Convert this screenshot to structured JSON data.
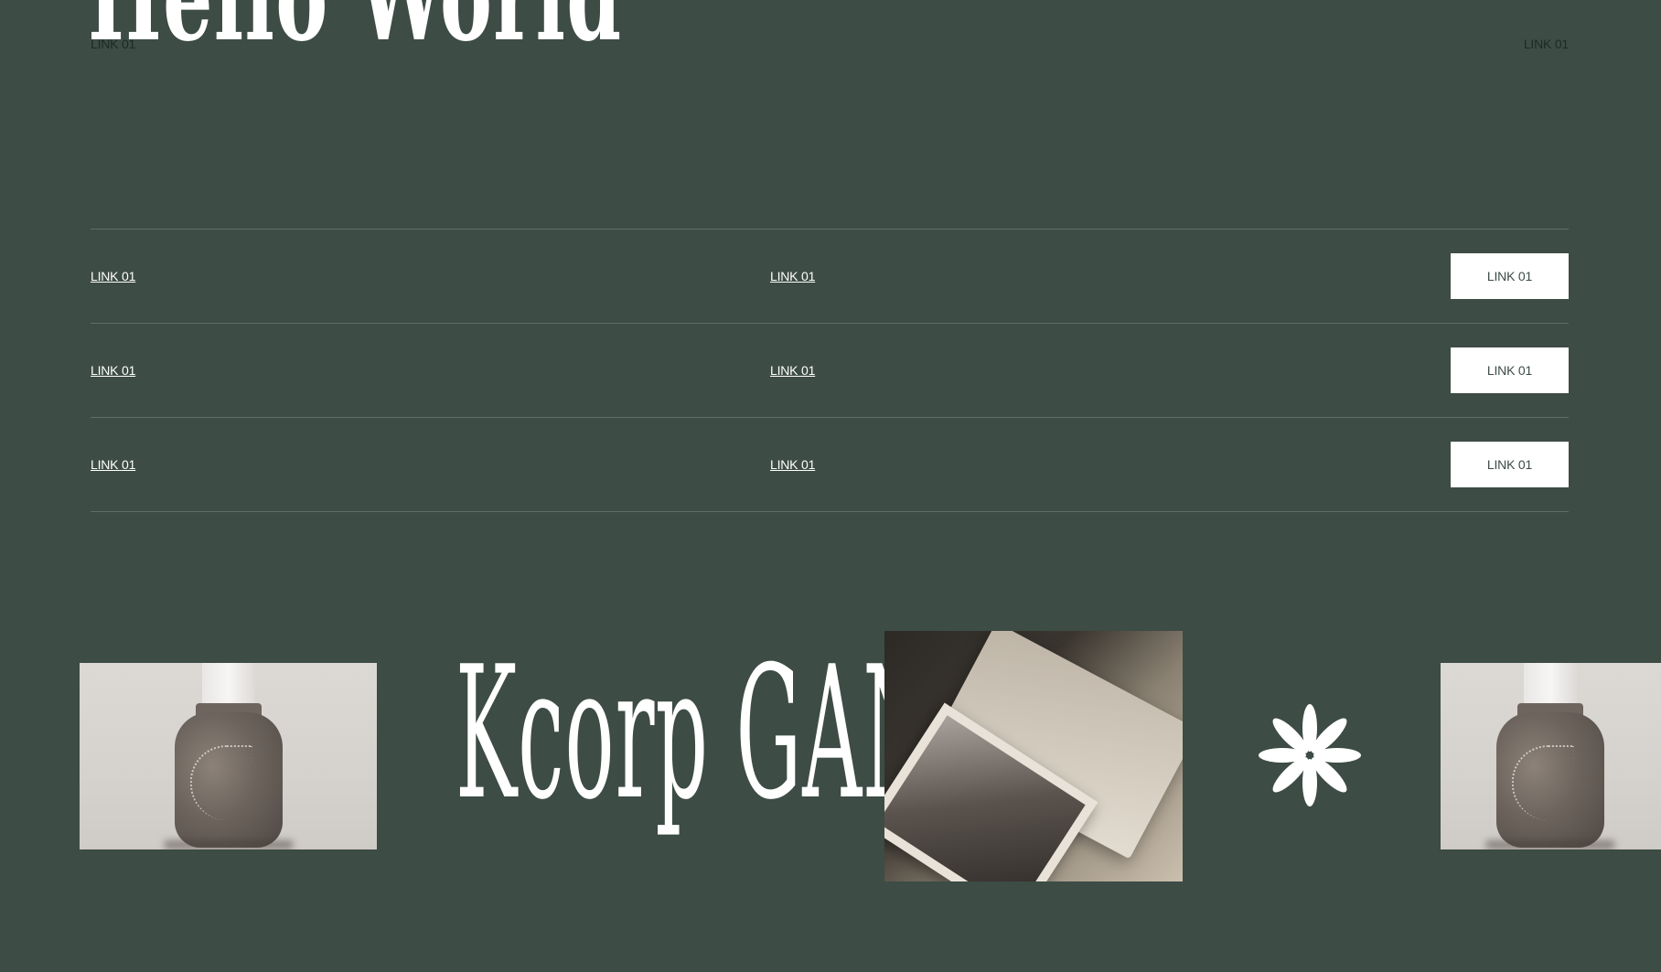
{
  "hero": {
    "title": "Hello World"
  },
  "nav": {
    "left_link": "LINK 01",
    "right_link": "LINK 01"
  },
  "rows": [
    {
      "col1": "LINK 01",
      "col2": "LINK 01",
      "button": "LINK 01"
    },
    {
      "col1": "LINK 01",
      "col2": "LINK 01",
      "button": "LINK 01"
    },
    {
      "col1": "LINK 01",
      "col2": "LINK 01",
      "button": "LINK 01"
    }
  ],
  "gallery": {
    "brand_word": "Kcorp GANG",
    "asterisk_icon": "asterisk-icon",
    "images": [
      "bottle-photo",
      "box-photo",
      "bottle-photo"
    ]
  },
  "colors": {
    "background": "#3d4c45",
    "text": "#ffffff",
    "button_bg": "#ffffff",
    "button_text": "#3d4c45",
    "divider": "#5f6e67"
  }
}
